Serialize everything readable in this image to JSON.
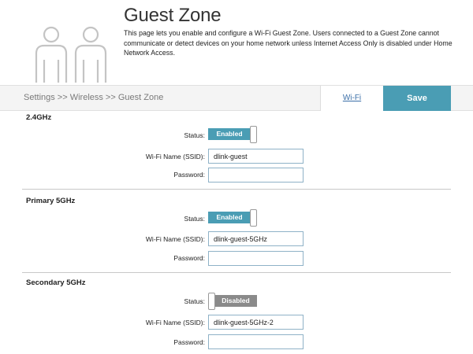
{
  "header": {
    "title": "Guest Zone",
    "description": "This page lets you enable and configure a Wi-Fi Guest Zone. Users connected to a Guest Zone cannot communicate or detect devices on your home network unless Internet Access Only is disabled under Home Network Access.",
    "icon": "users-icon"
  },
  "nav": {
    "breadcrumb": "Settings >> Wireless >> Guest Zone",
    "wifi_link": "Wi-Fi",
    "save_label": "Save"
  },
  "colors": {
    "accent": "#4a9db4",
    "toggle_off": "#8a8a8a",
    "link": "#3b6fa8"
  },
  "labels": {
    "status": "Status:",
    "ssid": "Wi-Fi Name (SSID):",
    "password": "Password:"
  },
  "sections": [
    {
      "title": "2.4GHz",
      "status": "Enabled",
      "enabled": true,
      "ssid": "dlink-guest",
      "password": ""
    },
    {
      "title": "Primary 5GHz",
      "status": "Enabled",
      "enabled": true,
      "ssid": "dlink-guest-5GHz",
      "password": ""
    },
    {
      "title": "Secondary 5GHz",
      "status": "Disabled",
      "enabled": false,
      "ssid": "dlink-guest-5GHz-2",
      "password": ""
    }
  ]
}
